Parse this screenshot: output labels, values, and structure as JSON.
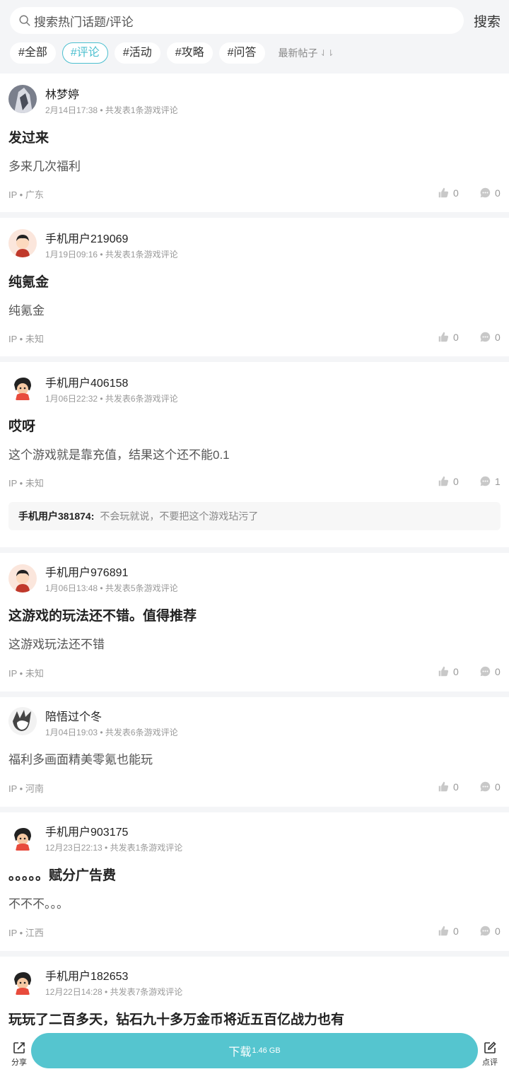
{
  "header": {
    "search_placeholder": "搜索热门话题/评论",
    "search_button": "搜索",
    "tags": [
      "#全部",
      "#评论",
      "#活动",
      "#攻略",
      "#问答"
    ],
    "active_tag": "#评论",
    "sort_label": "最新帖子"
  },
  "posts": [
    {
      "user": "林梦婷",
      "meta": "2月14日17:38 • 共发表1条游戏评论",
      "title": "发过来",
      "body": "多来几次福利",
      "ip": "IP • 广东",
      "likes": "0",
      "comments": "0"
    },
    {
      "user": "手机用户219069",
      "meta": "1月19日09:16 • 共发表1条游戏评论",
      "title": "纯氪金",
      "body": "纯氪金",
      "ip": "IP • 未知",
      "likes": "0",
      "comments": "0"
    },
    {
      "user": "手机用户406158",
      "meta": "1月06日22:32 • 共发表6条游戏评论",
      "title": "哎呀",
      "body": "这个游戏就是靠充值，结果这个还不能0.1",
      "ip": "IP • 未知",
      "likes": "0",
      "comments": "1",
      "reply_user": "手机用户381874:",
      "reply_text": "不会玩就说，不要把这个游戏玷污了"
    },
    {
      "user": "手机用户976891",
      "meta": "1月06日13:48 • 共发表5条游戏评论",
      "title": "这游戏的玩法还不错。值得推荐",
      "body": "这游戏玩法还不错",
      "ip": "IP • 未知",
      "likes": "0",
      "comments": "0"
    },
    {
      "user": "陪悟过个冬",
      "meta": "1月04日19:03 • 共发表6条游戏评论",
      "title": "",
      "body": "福利多画面精美零氪也能玩",
      "ip": "IP • 河南",
      "likes": "0",
      "comments": "0"
    },
    {
      "user": "手机用户903175",
      "meta": "12月23日22:13 • 共发表1条游戏评论",
      "title": "。。。。。赋分广告费",
      "body": "不不不。。。",
      "ip": "IP • 江西",
      "likes": "0",
      "comments": "0"
    },
    {
      "user": "手机用户182653",
      "meta": "12月22日14:28 • 共发表7条游戏评论",
      "title": "玩玩了二百多天，钻石九十多万金币将近五百亿战力也有",
      "body": "",
      "ip": "",
      "likes": "",
      "comments": ""
    }
  ],
  "bottom": {
    "share_label": "分享",
    "download_label": "下载",
    "download_size": "1.46 GB",
    "review_label": "点评"
  },
  "colors": {
    "accent": "#4bbfcf",
    "download_bg": "#55c5cf",
    "separator": "#f4f5f7"
  }
}
